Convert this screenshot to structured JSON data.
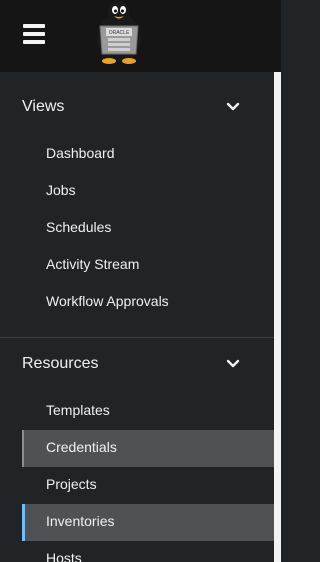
{
  "masthead": {
    "menu_icon": "hamburger-menu-icon",
    "logo_icon": "tux-penguin-logo-icon",
    "logo_badge_text": "ORACLE"
  },
  "sidebar": {
    "sections": [
      {
        "title": "Views",
        "chevron_icon": "chevron-down-icon",
        "items": [
          "Dashboard",
          "Jobs",
          "Schedules",
          "Activity Stream",
          "Workflow Approvals"
        ]
      },
      {
        "title": "Resources",
        "chevron_icon": "chevron-down-icon",
        "items": [
          "Templates",
          "Credentials",
          "Projects",
          "Inventories",
          "Hosts"
        ]
      }
    ],
    "hovered_item": "Credentials",
    "current_item": "Inventories"
  },
  "colors": {
    "masthead_bg": "#151515",
    "sidebar_bg": "#212427",
    "active_item_bg": "#4f5255",
    "active_accent": "#73bcf7"
  }
}
